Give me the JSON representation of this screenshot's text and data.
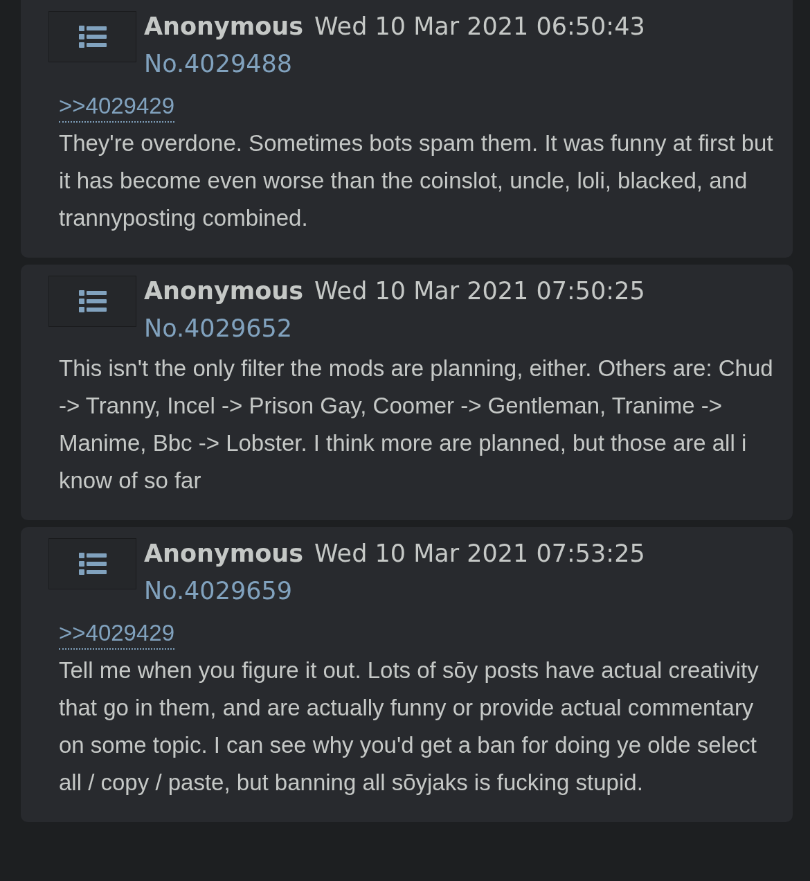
{
  "posts": [
    {
      "name": "Anonymous",
      "date": "Wed 10 Mar 2021 06:50:43",
      "number": "No.4029488",
      "quote": ">>4029429",
      "body": "They're overdone. Sometimes bots spam them. It was funny at first but it has become even worse than the coinslot, uncle, loli, blacked, and trannyposting combined."
    },
    {
      "name": "Anonymous",
      "date": "Wed 10 Mar 2021 07:50:25",
      "number": "No.4029652",
      "body": "This isn't the only filter the mods are planning, either. Others are: Chud -> Tranny, Incel -> Prison Gay, Coomer -> Gentleman, Tranime -> Manime, Bbc -> Lobster. I think more are planned, but those are all i know of so far"
    },
    {
      "name": "Anonymous",
      "date": "Wed 10 Mar 2021 07:53:25",
      "number": "No.4029659",
      "quote": ">>4029429",
      "body": "Tell me when you figure it out. Lots of sōy posts have actual creativity that go in them, and are actually funny or provide actual commentary on some topic. I can see why you'd get a ban for doing ye olde select all / copy / paste, but banning all sōyjaks is fucking stupid."
    }
  ]
}
